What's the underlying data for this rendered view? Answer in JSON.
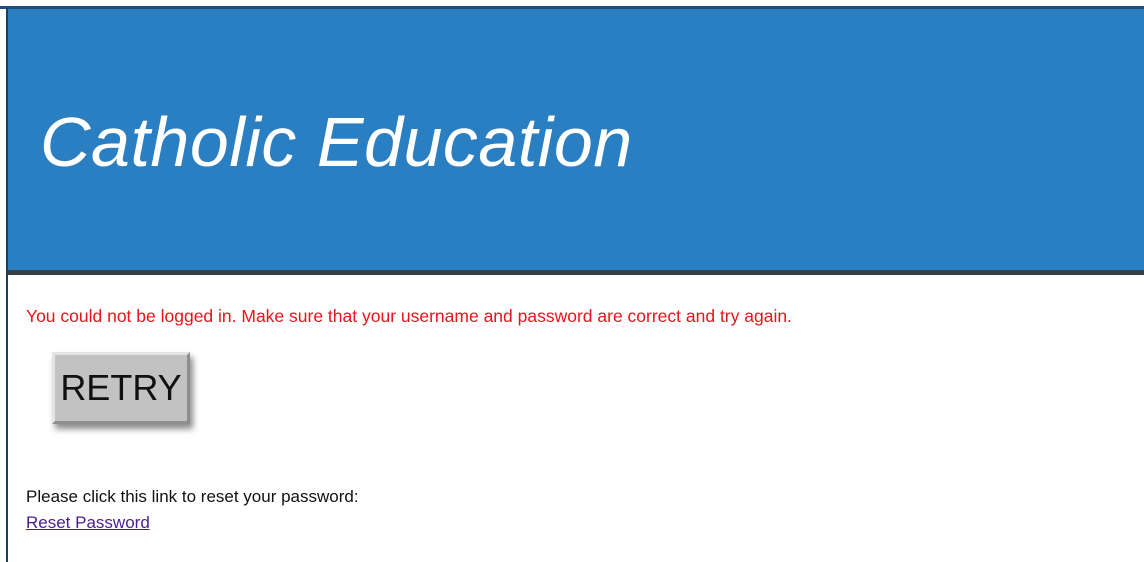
{
  "header": {
    "title": "Catholic Education",
    "background_color": "#2a7ec2"
  },
  "error": {
    "message": "You could not be logged in. Make sure that your username and password are correct and try again.",
    "color": "#e8141a"
  },
  "retry_button": {
    "label": "RETRY"
  },
  "reset": {
    "prompt": "Please click this link to reset your password:",
    "link_label": "Reset Password",
    "link_color": "#4b1f8a"
  }
}
